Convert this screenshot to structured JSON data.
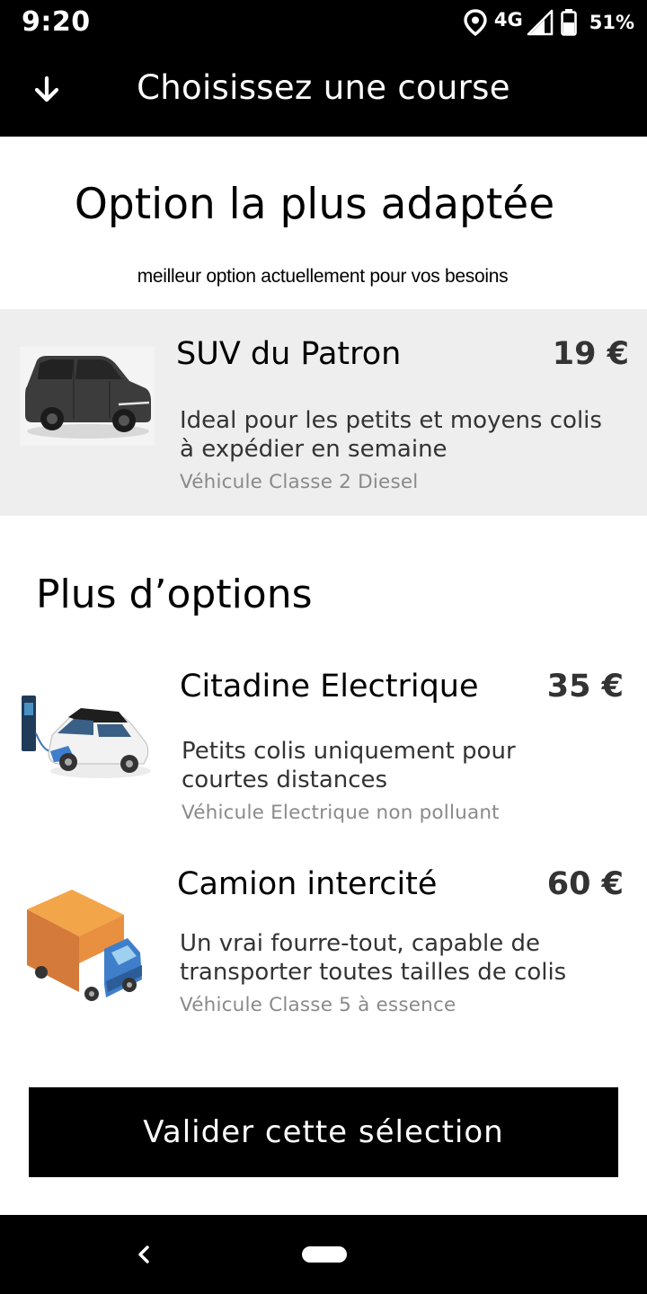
{
  "status_bar": {
    "time": "9:20",
    "network": "4G",
    "battery": "51%",
    "icons": [
      "location-icon",
      "signal-icon",
      "battery-icon"
    ]
  },
  "header": {
    "title": "Choisissez une course",
    "back_icon": "arrow-down-icon"
  },
  "best_option": {
    "section_title": "Option la plus adaptée",
    "section_subtitle": "meilleur option actuellement pour vos besoins",
    "name": "SUV du Patron",
    "price": "19 €",
    "description": "Ideal pour les petits et moyens colis à expédier en semaine",
    "meta": "Véhicule Classe 2 Diesel",
    "icon": "suv-car-icon"
  },
  "more_options": {
    "section_title": "Plus d’options",
    "items": [
      {
        "name": "Citadine Electrique",
        "price": "35 €",
        "description": "Petits colis uniquement pour courtes distances",
        "meta": "Véhicule Electrique non polluant",
        "icon": "electric-car-icon"
      },
      {
        "name": "Camion intercité",
        "price": "60 €",
        "description": "Un vrai fourre-tout, capable de transporter toutes tailles de colis",
        "meta": "Véhicule Classe 5 à essence",
        "icon": "truck-icon"
      }
    ]
  },
  "validate_button": {
    "label": "Valider cette sélection"
  },
  "colors": {
    "header_bg": "#000000",
    "selected_card_bg": "#eeeeee",
    "meta_text": "#8a8a8a",
    "price_text": "#333333"
  }
}
